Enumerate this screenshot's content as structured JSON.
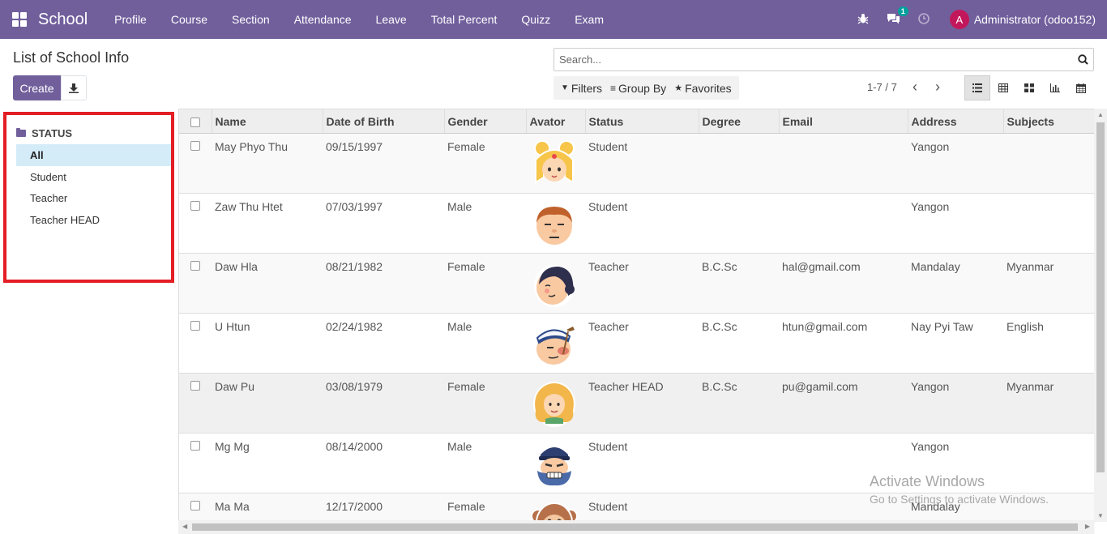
{
  "nav": {
    "brand": "School",
    "menu": [
      "Profile",
      "Course",
      "Section",
      "Attendance",
      "Leave",
      "Total Percent",
      "Quizz",
      "Exam"
    ],
    "messages_badge": "1",
    "avatar_letter": "A",
    "user": "Administrator (odoo152)"
  },
  "control": {
    "title": "List of School Info",
    "create_label": "Create",
    "search_placeholder": "Search...",
    "filters_label": "Filters",
    "groupby_label": "Group By",
    "favorites_label": "Favorites",
    "pager": "1-7 / 7"
  },
  "sidebar": {
    "header": "STATUS",
    "items": [
      {
        "label": "All",
        "active": true
      },
      {
        "label": "Student",
        "active": false
      },
      {
        "label": "Teacher",
        "active": false
      },
      {
        "label": "Teacher HEAD",
        "active": false
      }
    ]
  },
  "table": {
    "columns": [
      "Name",
      "Date of Birth",
      "Gender",
      "Avator",
      "Status",
      "Degree",
      "Email",
      "Address",
      "Subjects"
    ],
    "rows": [
      {
        "name": "May Phyo Thu",
        "dob": "09/15/1997",
        "gender": "Female",
        "avatar": "blonde-buns-avatar",
        "status": "Student",
        "degree": "",
        "email": "",
        "address": "Yangon",
        "subjects": ""
      },
      {
        "name": "Zaw Thu Htet",
        "dob": "07/03/1997",
        "gender": "Male",
        "avatar": "bored-man-avatar",
        "status": "Student",
        "degree": "",
        "email": "",
        "address": "Yangon",
        "subjects": ""
      },
      {
        "name": "Daw Hla",
        "dob": "08/21/1982",
        "gender": "Female",
        "avatar": "dark-hair-woman-avatar",
        "status": "Teacher",
        "degree": "B.C.Sc",
        "email": "hal@gmail.com",
        "address": "Mandalay",
        "subjects": "Myanmar"
      },
      {
        "name": "U Htun",
        "dob": "02/24/1982",
        "gender": "Male",
        "avatar": "sailor-pipe-avatar",
        "status": "Teacher",
        "degree": "B.C.Sc",
        "email": "htun@gmail.com",
        "address": "Nay Pyi Taw",
        "subjects": "English"
      },
      {
        "name": "Daw Pu",
        "dob": "03/08/1979",
        "gender": "Female",
        "avatar": "curly-blonde-avatar",
        "status": "Teacher HEAD",
        "degree": "B.C.Sc",
        "email": "pu@gamil.com",
        "address": "Yangon",
        "subjects": "Myanmar"
      },
      {
        "name": "Mg Mg",
        "dob": "08/14/2000",
        "gender": "Male",
        "avatar": "bearded-captain-avatar",
        "status": "Student",
        "degree": "",
        "email": "",
        "address": "Yangon",
        "subjects": ""
      },
      {
        "name": "Ma Ma",
        "dob": "12/17/2000",
        "gender": "Female",
        "avatar": "monkey-avatar",
        "status": "Student",
        "degree": "",
        "email": "",
        "address": "Mandalay",
        "subjects": ""
      }
    ]
  },
  "watermark": {
    "title": "Activate Windows",
    "subtitle": "Go to Settings to activate Windows."
  },
  "colors": {
    "brand": "#715f9c",
    "highlight_border": "#e31e24",
    "active_filter": "#d4ecf8"
  }
}
